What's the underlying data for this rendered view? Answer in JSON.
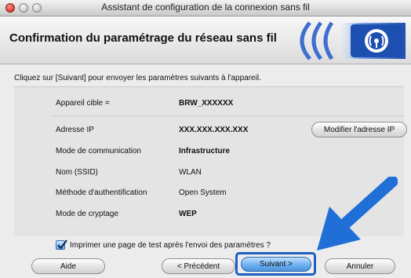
{
  "window": {
    "title": "Assistant de configuration de la connexion sans fil"
  },
  "header": {
    "title": "Confirmation du paramétrage du réseau sans fil",
    "logo_icon": "wifi-signal-icon"
  },
  "instruction": "Cliquez sur [Suivant] pour envoyer les paramètres suivants à l'appareil.",
  "settings": {
    "target_label": "Appareil cible =",
    "target_value": "BRW_XXXXXX",
    "ip_label": "Adresse IP",
    "ip_value": "XXX.XXX.XXX.XXX",
    "mode_label": "Mode de communication",
    "mode_value": "Infrastructure",
    "ssid_label": "Nom (SSID)",
    "ssid_value": "WLAN",
    "auth_label": "Méthode d'authentification",
    "auth_value": "Open System",
    "crypto_label": "Mode de cryptage",
    "crypto_value": "WEP"
  },
  "buttons": {
    "modify_ip": "Modifier l'adresse IP",
    "help": "Aide",
    "previous": "< Précédent",
    "next": "Suivant >",
    "cancel": "Annuler"
  },
  "checkbox": {
    "label": "Imprimer une page de test après l'envoi des paramètres ?",
    "checked": true
  },
  "colors": {
    "accent_blue": "#1e5fc2",
    "arrow_blue": "#1f6fd6"
  }
}
